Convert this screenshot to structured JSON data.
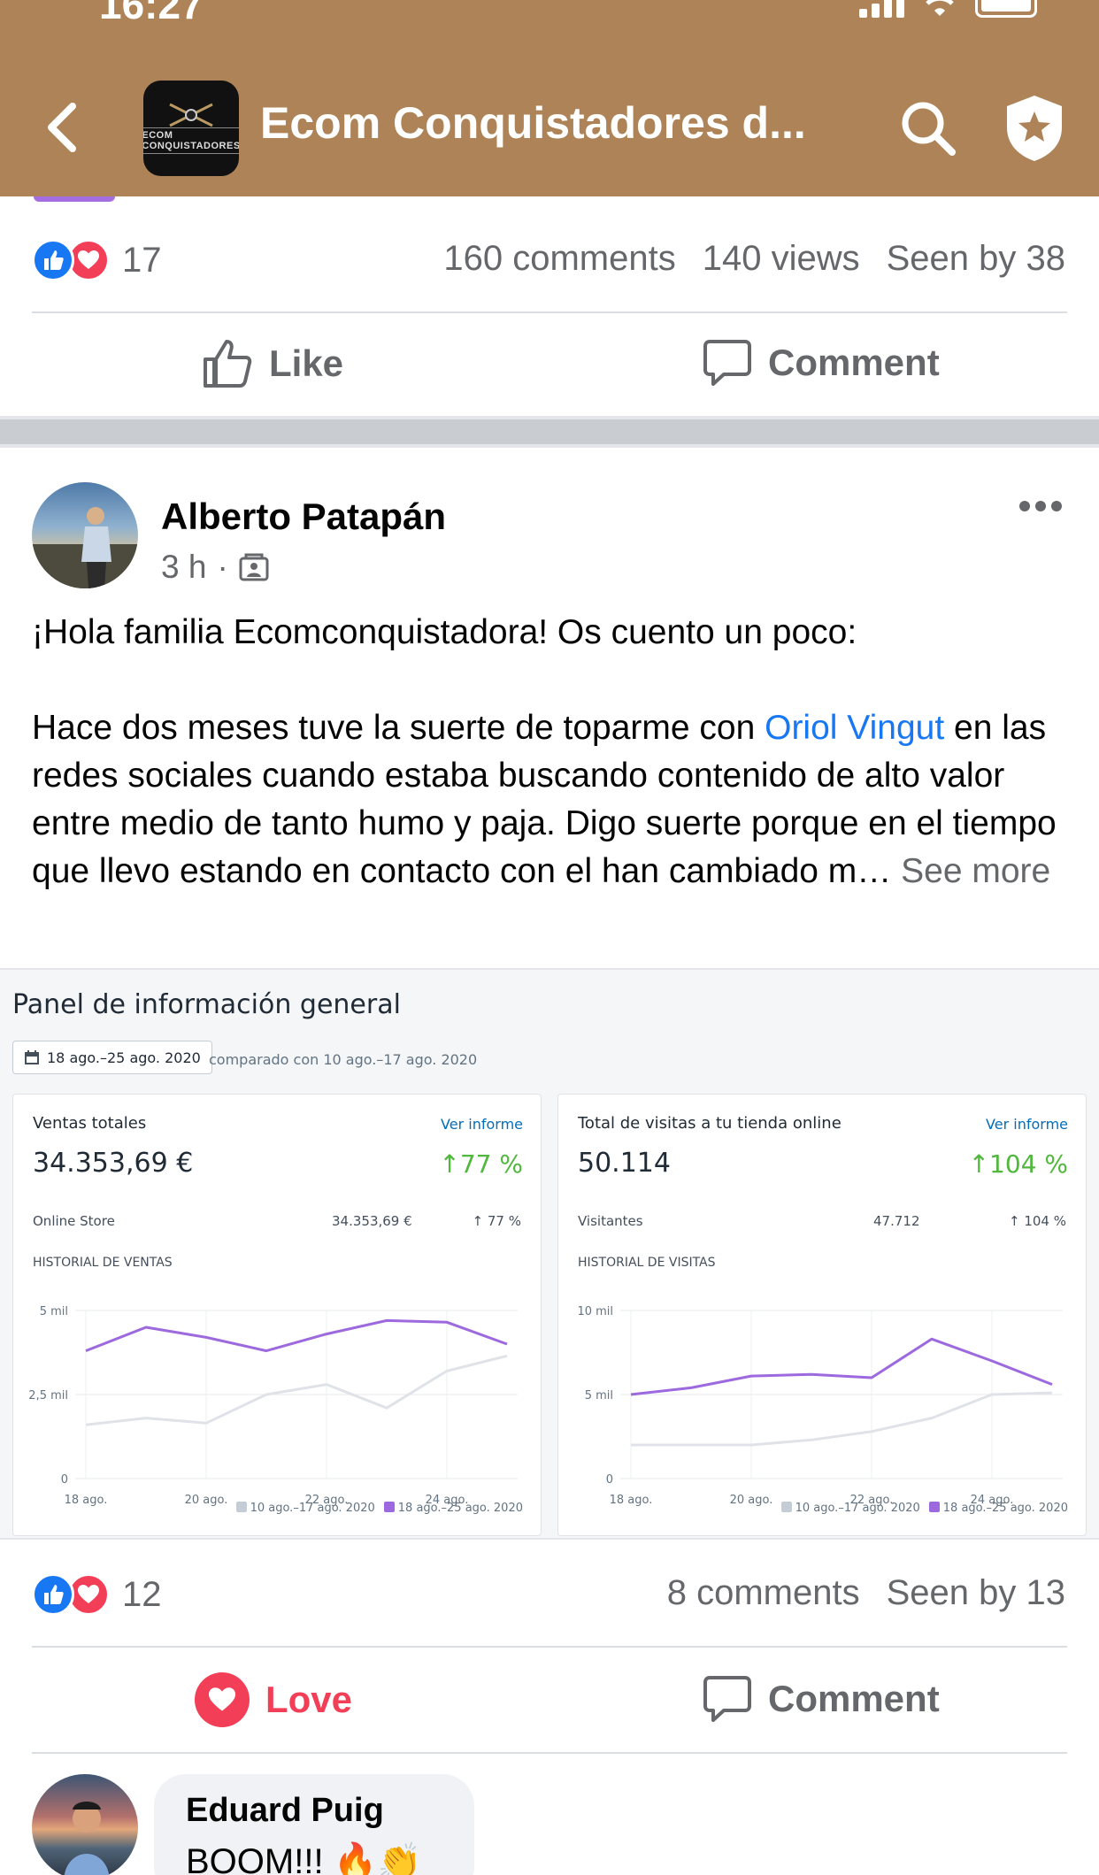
{
  "status_bar": {
    "time": "16:27"
  },
  "header": {
    "group_title": "Ecom Conquistadores d...",
    "group_avatar_text": "ECOM CONQUISTADORES",
    "back_icon": "chevron-left-icon",
    "search_icon": "search-icon",
    "admin_icon": "shield-star-icon",
    "background_color": "#ad8357"
  },
  "previous_post": {
    "reaction_count": "17",
    "comments": "160 comments",
    "views": "140 views",
    "seen_by": "Seen by 38",
    "like_label": "Like",
    "comment_label": "Comment"
  },
  "post": {
    "author": "Alberto Patapán",
    "time": "3 h",
    "separator": "·",
    "paragraph_1": "¡Hola familia Ecomconquistadora! Os cuento un poco:",
    "paragraph_2_before": "Hace dos meses tuve la suerte de toparme con ",
    "mention": "Oriol Vingut",
    "paragraph_2_after": " en las redes sociales cuando estaba buscando contenido de alto valor entre medio de tanto humo y paja. Digo suerte porque en el tiempo que llevo estando en contacto con el han cambiado m…",
    "see_more": "See more",
    "reaction_count": "12",
    "comments": "8 comments",
    "seen_by": "Seen by 13",
    "love_label": "Love",
    "comment_label": "Comment"
  },
  "dashboard": {
    "title": "Panel de información general",
    "date_range": "18 ago.–25 ago. 2020",
    "comparison": "comparado con 10 ago.–17 ago. 2020",
    "cards": [
      {
        "label": "Ventas totales",
        "link": "Ver informe",
        "total": "34.353,69 €",
        "change": "↑77 %",
        "row_label": "Online Store",
        "row_value": "34.353,69 €",
        "row_pct": "↑ 77 %",
        "history_label": "HISTORIAL DE VENTAS"
      },
      {
        "label": "Total de visitas a tu tienda online",
        "link": "Ver informe",
        "total": "50.114",
        "change": "↑104 %",
        "row_label": "Visitantes",
        "row_value": "47.712",
        "row_pct": "↑ 104 %",
        "history_label": "HISTORIAL DE VISITAS"
      }
    ],
    "legend_previous": "10 ago.–17 ago. 2020",
    "legend_current": "18 ago.–25 ago. 2020",
    "series_colors": {
      "current": "#9c6ade",
      "previous": "#dfe3e8"
    }
  },
  "chart_data": [
    {
      "type": "line",
      "x": [
        "18 ago.",
        "19 ago.",
        "20 ago.",
        "21 ago.",
        "22 ago.",
        "23 ago.",
        "24 ago.",
        "25 ago."
      ],
      "xticks": [
        "18 ago.",
        "20 ago.",
        "22 ago.",
        "24 ago."
      ],
      "yticks": [
        "5 mil",
        "2,5 mil",
        "0"
      ],
      "ylim": [
        0,
        5000
      ],
      "series": [
        {
          "name": "18 ago.–25 ago. 2020",
          "values": [
            3800,
            4500,
            4200,
            3800,
            4300,
            4700,
            4650,
            4000
          ]
        },
        {
          "name": "10 ago.–17 ago. 2020",
          "values": [
            1600,
            1800,
            1650,
            2500,
            2800,
            2100,
            3200,
            3650
          ]
        }
      ]
    },
    {
      "type": "line",
      "x": [
        "18 ago.",
        "19 ago.",
        "20 ago.",
        "21 ago.",
        "22 ago.",
        "23 ago.",
        "24 ago.",
        "25 ago."
      ],
      "xticks": [
        "18 ago.",
        "20 ago.",
        "22 ago.",
        "24 ago."
      ],
      "yticks": [
        "10 mil",
        "5 mil",
        "0"
      ],
      "ylim": [
        0,
        10000
      ],
      "series": [
        {
          "name": "18 ago.–25 ago. 2020",
          "values": [
            5000,
            5400,
            6100,
            6200,
            6000,
            8300,
            7000,
            5600
          ]
        },
        {
          "name": "10 ago.–17 ago. 2020",
          "values": [
            2000,
            2000,
            2000,
            2300,
            2800,
            3600,
            5000,
            5100
          ]
        }
      ]
    }
  ],
  "comment": {
    "author": "Eduard Puig",
    "text": "BOOM!!! 🔥👏"
  }
}
